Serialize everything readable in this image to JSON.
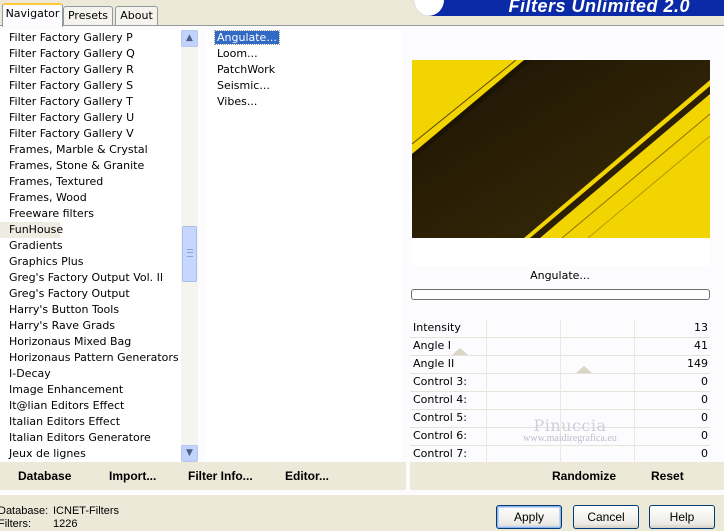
{
  "tabs": [
    {
      "label": "Navigator",
      "active": true
    },
    {
      "label": "Presets",
      "active": false
    },
    {
      "label": "About",
      "active": false
    }
  ],
  "banner": {
    "title": "Filters Unlimited 2.0"
  },
  "categories": {
    "items": [
      "Filter Factory Gallery P",
      "Filter Factory Gallery Q",
      "Filter Factory Gallery R",
      "Filter Factory Gallery S",
      "Filter Factory Gallery T",
      "Filter Factory Gallery U",
      "Filter Factory Gallery V",
      "Frames, Marble & Crystal",
      "Frames, Stone & Granite",
      "Frames, Textured",
      "Frames, Wood",
      "Freeware filters",
      "FunHouse",
      "Gradients",
      "Graphics Plus",
      "Greg's Factory Output Vol. II",
      "Greg's Factory Output",
      "Harry's Button Tools",
      "Harry's Rave Grads",
      "Horizonaus Mixed Bag",
      "Horizonaus Pattern Generators",
      "I-Decay",
      "Image Enhancement",
      "It@lian Editors Effect",
      "Italian Editors Effect",
      "Italian Editors Generatore",
      "Jeux de lignes"
    ],
    "selected": "FunHouse"
  },
  "filters": {
    "items": [
      "Angulate...",
      "Loom...",
      "PatchWork",
      "Seismic...",
      "Vibes..."
    ],
    "selected": "Angulate..."
  },
  "preview": {
    "filter_name": "Angulate...",
    "colors": {
      "yellow": "#f2d400",
      "dark": "#3a2a05"
    }
  },
  "controls": [
    {
      "label": "Intensity",
      "value": "13"
    },
    {
      "label": "Angle I",
      "value": "41"
    },
    {
      "label": "Angle II",
      "value": "149"
    },
    {
      "label": "Control 3:",
      "value": "0"
    },
    {
      "label": "Control 4:",
      "value": "0"
    },
    {
      "label": "Control 5:",
      "value": "0"
    },
    {
      "label": "Control 6:",
      "value": "0"
    },
    {
      "label": "Control 7:",
      "value": "0"
    }
  ],
  "toolbar": {
    "database": "Database",
    "import": "Import...",
    "filter_info": "Filter Info...",
    "editor": "Editor...",
    "randomize": "Randomize",
    "reset": "Reset"
  },
  "watermark": {
    "signature": "Pinuccia",
    "url": "www.maidiregrafica.eu"
  },
  "status": {
    "database_label": "Database:",
    "database_value": "ICNET-Filters",
    "filters_label": "Filters:",
    "filters_value": "1226"
  },
  "buttons": {
    "apply": "Apply",
    "cancel": "Cancel",
    "help": "Help"
  }
}
